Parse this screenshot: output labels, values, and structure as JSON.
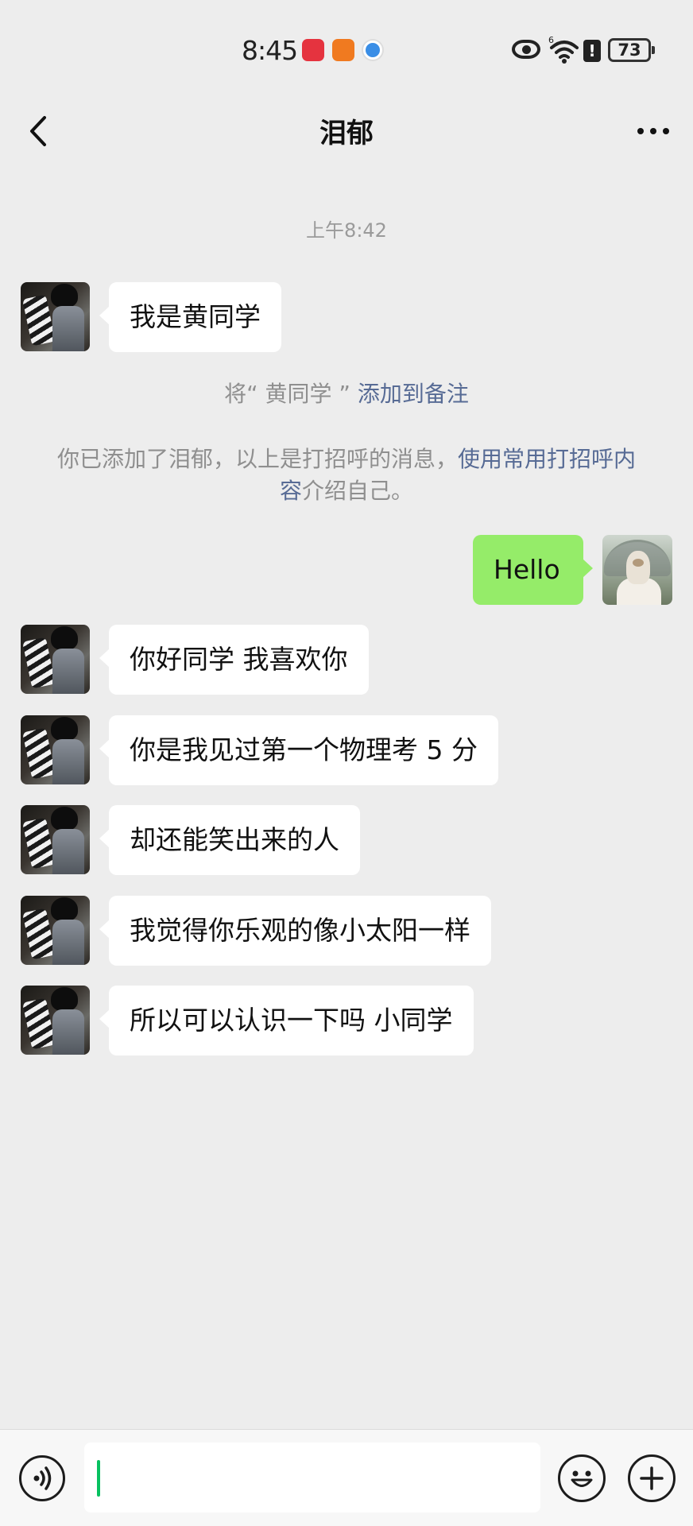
{
  "status_bar": {
    "time": "8:45",
    "signal_label": "6",
    "alert_glyph": "!",
    "battery_level": "73"
  },
  "nav": {
    "title": "泪郁",
    "back_icon": "chevron-left-icon",
    "more_icon": "more-dots-icon"
  },
  "chat": {
    "timestamp": "上午8:42",
    "first_message": "我是黄同学",
    "remark_note": {
      "prefix": "将“ 黄同学 ”",
      "link": "添加到备注"
    },
    "greeting_note": {
      "text": "你已添加了泪郁，以上是打招呼的消息，",
      "link": "使用常用打招呼内容",
      "suffix": "介绍自己。"
    },
    "my_message": "Hello",
    "messages": [
      "你好同学  我喜欢你",
      "你是我见过第一个物理考 5 分",
      "却还能笑出来的人",
      "我觉得你乐观的像小太阳一样",
      "所以可以认识一下吗  小同学"
    ]
  },
  "input_bar": {
    "voice_icon": "voice-icon",
    "emoji_icon": "emoji-icon",
    "plus_icon": "plus-icon",
    "input_value": ""
  },
  "colors": {
    "background": "#ededed",
    "my_bubble": "#95ec69",
    "their_bubble": "#ffffff",
    "link": "#576b95",
    "cursor": "#07c160"
  }
}
